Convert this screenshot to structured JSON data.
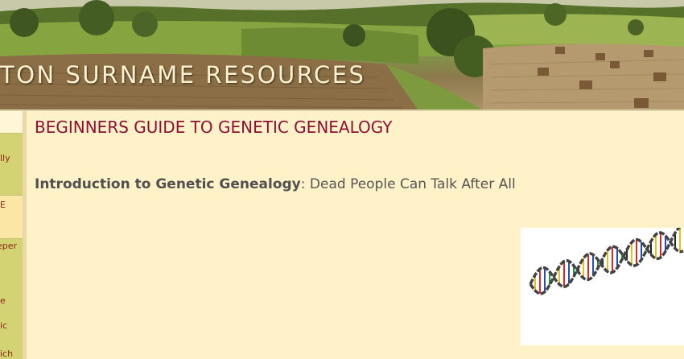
{
  "banner": {
    "title": "TON SURNAME RESOURCES"
  },
  "sidebar": {
    "items": [
      {
        "label": "lly"
      },
      {
        "label": "E"
      },
      {
        "label": "eper"
      },
      {
        "label": "e"
      },
      {
        "label": "ic"
      },
      {
        "label": "ich"
      }
    ]
  },
  "main": {
    "heading": "BEGINNERS GUIDE TO GENETIC GENEALOGY",
    "intro_link": "Introduction to Genetic Genealogy",
    "intro_sep": ":",
    "intro_rest": " Dead People Can Talk After All"
  },
  "image": {
    "icon": "dna-double-helix-icon"
  },
  "colors": {
    "page_bg": "#fff2c8",
    "heading": "#8c1035",
    "sidebar_bg": "#d4d374",
    "sidebar_link": "#8a2a10",
    "banner_text": "#fff3cf"
  }
}
